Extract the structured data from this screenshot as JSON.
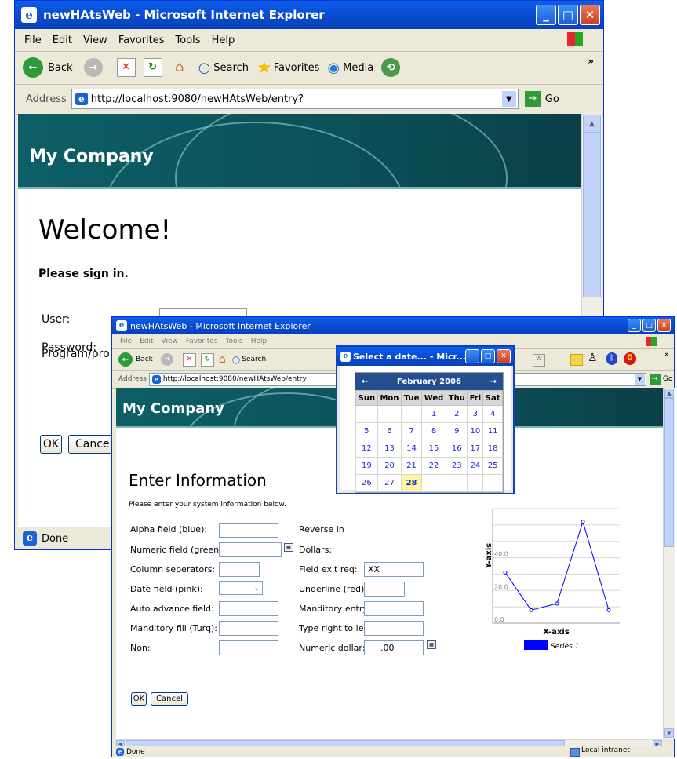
{
  "win1": {
    "title": "newHAtsWeb - Microsoft Internet Explorer",
    "menu": [
      "File",
      "Edit",
      "View",
      "Favorites",
      "Tools",
      "Help"
    ],
    "toolbar": {
      "back": "Back",
      "search": "Search",
      "favorites": "Favorites",
      "media": "Media"
    },
    "address_label": "Address",
    "address_url": "http://localhost:9080/newHAtsWeb/entry?",
    "go_label": "Go",
    "banner": "My Company",
    "heading": "Welcome!",
    "subheading": "Please sign in.",
    "labels": {
      "user": "User:",
      "password": "Password:",
      "program": "Program/pro"
    },
    "ok_label": "OK",
    "cancel_label": "Cance",
    "status": "Done"
  },
  "win2": {
    "title": "newHAtsWeb - Microsoft Internet Explorer",
    "menu": [
      "File",
      "Edit",
      "View",
      "Favorites",
      "Tools",
      "Help"
    ],
    "toolbar": {
      "back": "Back",
      "search": "Search"
    },
    "address_label": "Address",
    "address_url": "http://localhost:9080/newHAtsWeb/entry",
    "go_label": "Go",
    "banner": "My Company",
    "heading": "Enter Information",
    "instructions": "Please enter your system information below.",
    "left_labels": [
      "Alpha field (blue):",
      "Numeric field (green):",
      "Column seperators:",
      "Date field (pink):",
      "Auto advance field:",
      "Manditory fill (Turq):",
      "Non:"
    ],
    "right_labels": [
      "Reverse in",
      "Dollars:",
      "Field exit req:",
      "Underline (red):",
      "Manditory entry:",
      "Type right to left:",
      "Numeric dollar:"
    ],
    "field_exit_value": "XX",
    "numeric_dollar_value": ".00",
    "ok_label": "OK",
    "cancel_label": "Cancel",
    "status": "Done",
    "zone": "Local intranet"
  },
  "datepicker": {
    "title": "Select a date... - Micr...",
    "month": "February 2006",
    "prev": "←",
    "next": "→",
    "days": [
      "Sun",
      "Mon",
      "Tue",
      "Wed",
      "Thu",
      "Fri",
      "Sat"
    ],
    "weeks": [
      [
        "",
        "",
        "",
        "1",
        "2",
        "3",
        "4"
      ],
      [
        "5",
        "6",
        "7",
        "8",
        "9",
        "10",
        "11"
      ],
      [
        "12",
        "13",
        "14",
        "15",
        "16",
        "17",
        "18"
      ],
      [
        "19",
        "20",
        "21",
        "22",
        "23",
        "24",
        "25"
      ],
      [
        "26",
        "27",
        "28",
        "",
        "",
        "",
        ""
      ]
    ],
    "selected": "28"
  },
  "chart_data": {
    "type": "line",
    "xlabel": "X-axis",
    "ylabel": "Y-axis",
    "y_ticks": [
      "0.0",
      "20.0",
      "40.0"
    ],
    "ylim": [
      0,
      70
    ],
    "series": [
      {
        "name": "Series 1",
        "values": [
          31,
          8,
          12,
          62,
          8
        ]
      }
    ],
    "legend_position": "bottom",
    "color": "#0000ff"
  }
}
